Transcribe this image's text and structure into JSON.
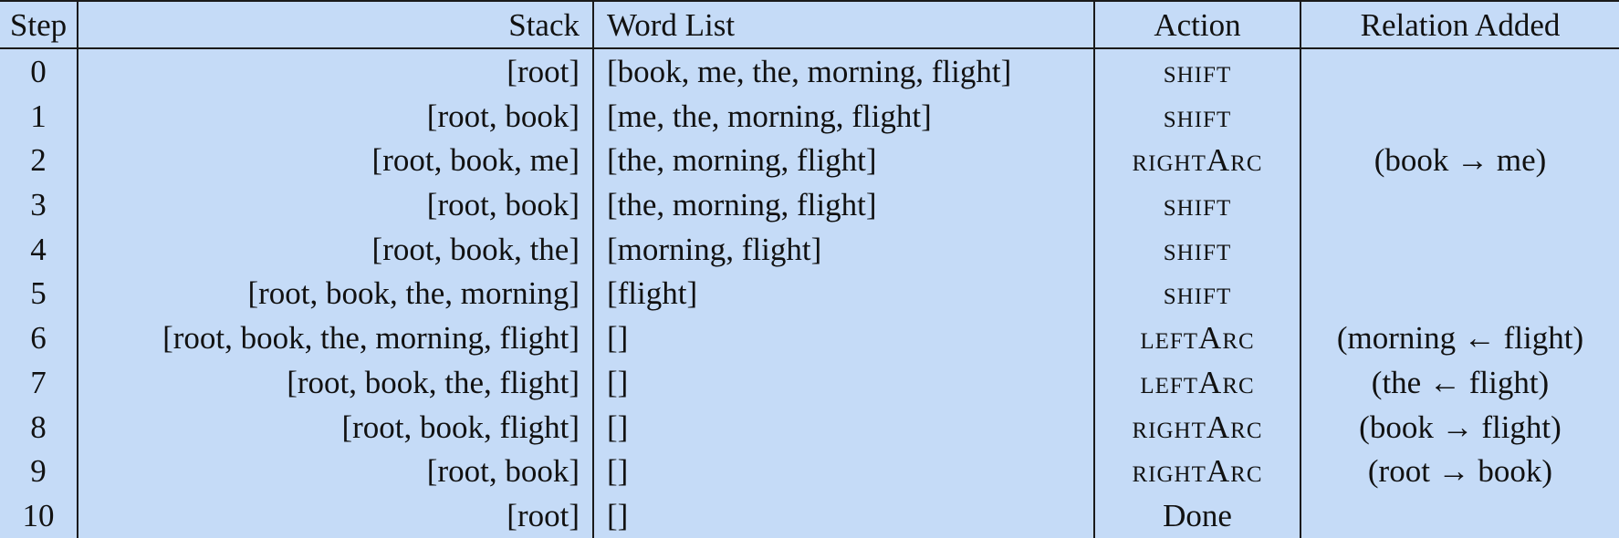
{
  "table": {
    "headers": {
      "step": "Step",
      "stack": "Stack",
      "words": "Word List",
      "action": "Action",
      "relation": "Relation Added"
    },
    "rows": [
      {
        "step": "0",
        "stack": "[root]",
        "words": "[book, me, the, morning, flight]",
        "action": "shift",
        "relation": ""
      },
      {
        "step": "1",
        "stack": "[root, book]",
        "words": "[me, the, morning, flight]",
        "action": "shift",
        "relation": ""
      },
      {
        "step": "2",
        "stack": "[root, book, me]",
        "words": "[the, morning, flight]",
        "action": "rightArc",
        "relation": "(book → me)"
      },
      {
        "step": "3",
        "stack": "[root, book]",
        "words": "[the, morning, flight]",
        "action": "shift",
        "relation": ""
      },
      {
        "step": "4",
        "stack": "[root, book, the]",
        "words": "[morning, flight]",
        "action": "shift",
        "relation": ""
      },
      {
        "step": "5",
        "stack": "[root, book, the, morning]",
        "words": "[flight]",
        "action": "shift",
        "relation": ""
      },
      {
        "step": "6",
        "stack": "[root, book, the, morning, flight]",
        "words": "[]",
        "action": "leftArc",
        "relation": "(morning ← flight)"
      },
      {
        "step": "7",
        "stack": "[root, book, the, flight]",
        "words": "[]",
        "action": "leftArc",
        "relation": "(the ← flight)"
      },
      {
        "step": "8",
        "stack": "[root, book, flight]",
        "words": "[]",
        "action": "rightArc",
        "relation": "(book → flight)"
      },
      {
        "step": "9",
        "stack": "[root, book]",
        "words": "[]",
        "action": "rightArc",
        "relation": "(root → book)"
      },
      {
        "step": "10",
        "stack": "[root]",
        "words": "[]",
        "action": "Done",
        "relation": ""
      }
    ]
  }
}
